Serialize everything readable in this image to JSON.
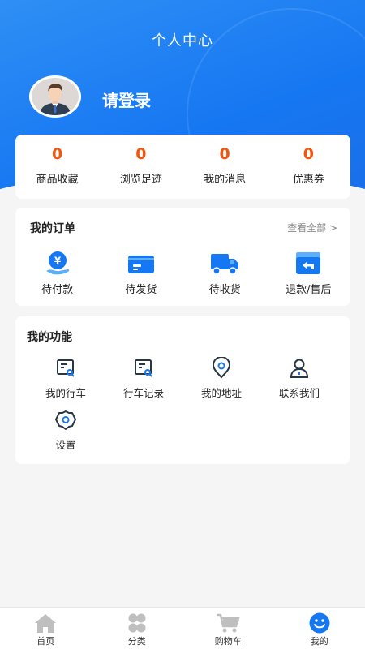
{
  "header": {
    "title": "个人中心",
    "login_text": "请登录"
  },
  "stats": [
    {
      "value": "0",
      "label": "商品收藏"
    },
    {
      "value": "0",
      "label": "浏览足迹"
    },
    {
      "value": "0",
      "label": "我的消息"
    },
    {
      "value": "0",
      "label": "优惠券"
    }
  ],
  "orders": {
    "title": "我的订单",
    "more": "查看全部 >",
    "items": [
      {
        "label": "待付款",
        "icon": "yuan-coin-icon"
      },
      {
        "label": "待发货",
        "icon": "card-icon"
      },
      {
        "label": "待收货",
        "icon": "truck-icon"
      },
      {
        "label": "退款/售后",
        "icon": "refund-icon"
      }
    ]
  },
  "functions": {
    "title": "我的功能",
    "items": [
      {
        "label": "我的行车",
        "icon": "document-search-icon"
      },
      {
        "label": "行车记录",
        "icon": "record-icon"
      },
      {
        "label": "我的地址",
        "icon": "location-pin-icon"
      },
      {
        "label": "联系我们",
        "icon": "contact-person-icon"
      },
      {
        "label": "设置",
        "icon": "settings-gear-icon"
      }
    ]
  },
  "tabbar": [
    {
      "label": "首页",
      "icon": "home-icon"
    },
    {
      "label": "分类",
      "icon": "category-icon"
    },
    {
      "label": "购物车",
      "icon": "cart-icon"
    },
    {
      "label": "我的",
      "icon": "profile-face-icon",
      "active": true
    }
  ],
  "colors": {
    "brand_blue": "#1677f2",
    "stat_orange": "#f4540c",
    "icon_gray": "#bfbfbf",
    "dark_navy": "#273746"
  }
}
